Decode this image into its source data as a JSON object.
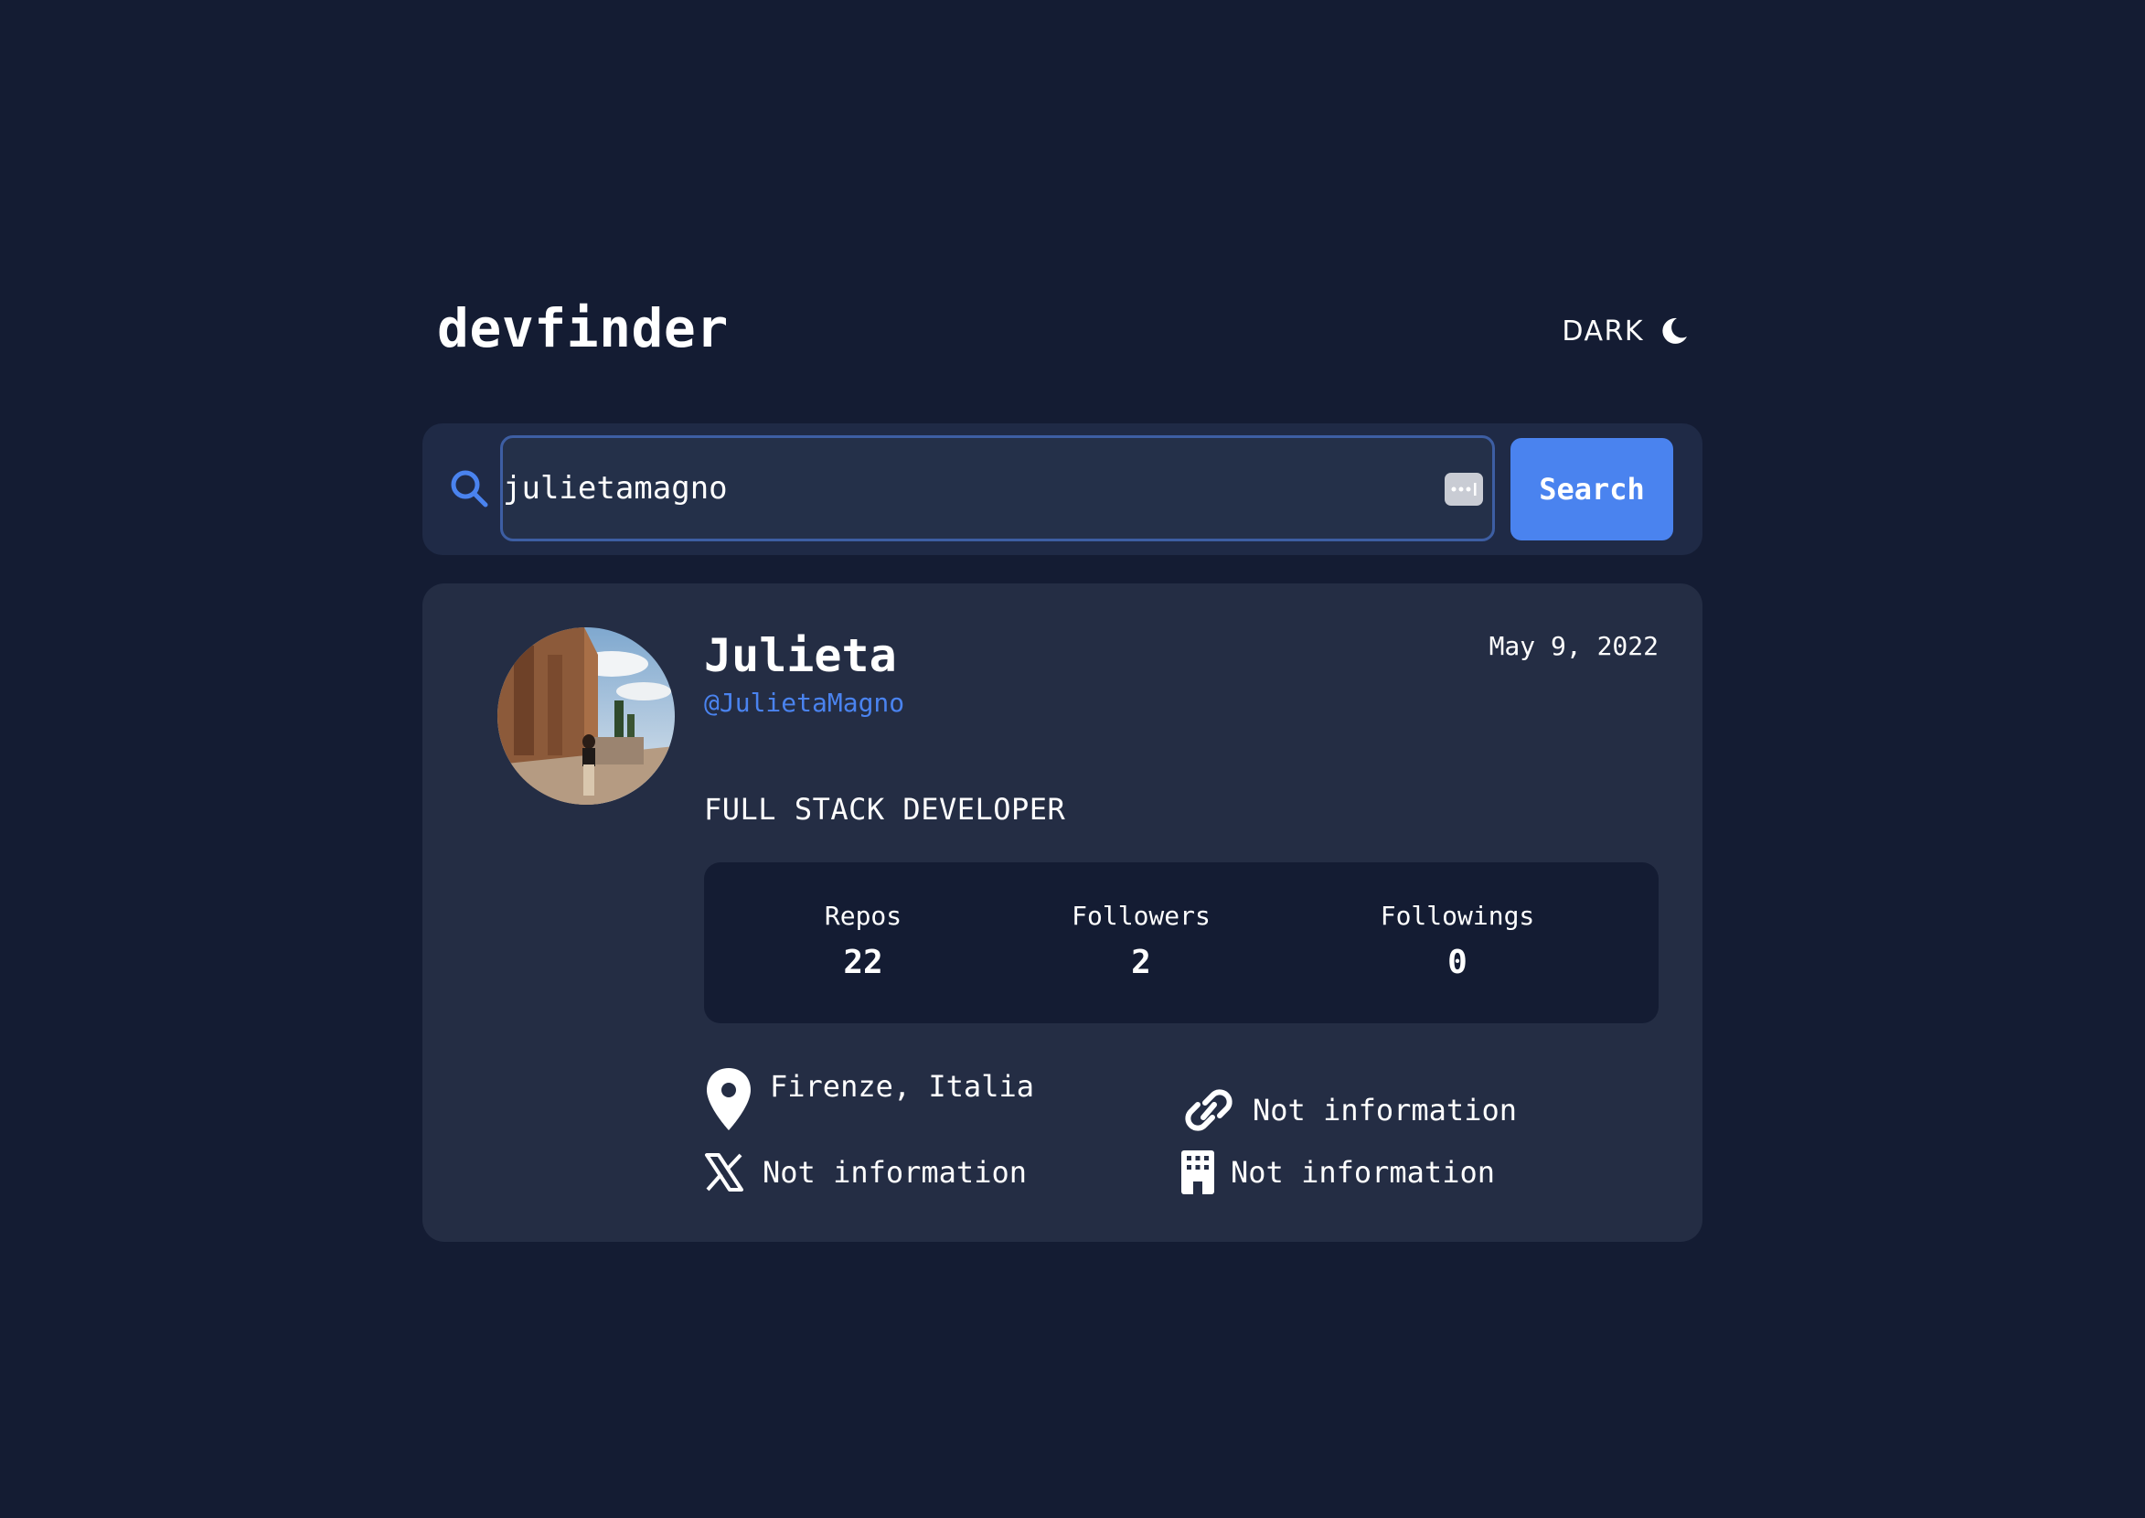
{
  "header": {
    "logo": "devfinder",
    "theme_label": "DARK",
    "theme_icon": "moon-icon"
  },
  "search": {
    "icon": "search-icon",
    "value": "julietamagno",
    "placeholder": "",
    "button_label": "Search"
  },
  "profile": {
    "avatar_icon": "avatar",
    "name": "Julieta",
    "username": "@JulietaMagno",
    "joined": "May 9, 2022",
    "bio": "FULL STACK DEVELOPER",
    "stats": {
      "repos_label": "Repos",
      "repos_value": "22",
      "followers_label": "Followers",
      "followers_value": "2",
      "following_label": "Followings",
      "following_value": "0"
    },
    "info": {
      "location": "Firenze, Italia",
      "blog": "Not information",
      "twitter": "Not information",
      "company": "Not information"
    }
  },
  "colors": {
    "background": "#141c33",
    "card": "#242d44",
    "accent": "#4a83ef",
    "text": "#ffffff"
  }
}
